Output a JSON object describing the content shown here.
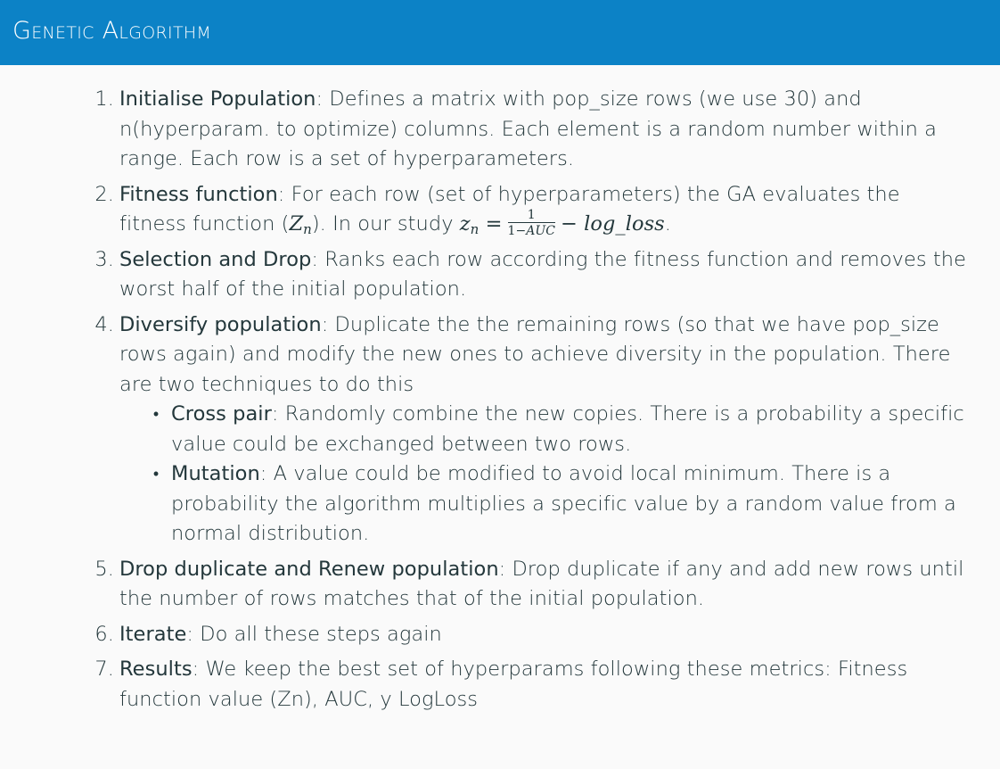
{
  "header": {
    "title": "Genetic Algorithm"
  },
  "steps": [
    {
      "number": "1.",
      "term": "Initialise Population",
      "text": ": Defines a matrix with pop_size rows (we use 30) and n(hyperparam. to optimize) columns. Each element is a random number within a range. Each row is a set of hyperparameters."
    },
    {
      "number": "2.",
      "term": "Fitness function",
      "text_before": ": For each row (set of hyperparameters) the GA evaluates the fitness function (",
      "math_z_var": "Z",
      "math_z_sub": "n",
      "text_mid": "). In our study ",
      "math_lhs_var": "z",
      "math_lhs_sub": "n",
      "math_equals": "=",
      "frac_num": "1",
      "frac_den_prefix": "1−",
      "frac_den_var": "AUC",
      "math_minus": "−",
      "math_rhs": "log_loss",
      "text_after": "."
    },
    {
      "number": "3.",
      "term": "Selection and Drop",
      "text": ": Ranks each row according the fitness function and removes the worst half of the initial population."
    },
    {
      "number": "4.",
      "term": "Diversify population",
      "text": ": Duplicate the the remaining rows (so that we have pop_size rows again) and modify the new ones to achieve diversity in the population. There are two techniques to do this",
      "subitems": [
        {
          "bullet": "•",
          "term": "Cross pair",
          "text": ": Randomly combine the new copies. There is a probability a specific value could be exchanged between two rows."
        },
        {
          "bullet": "•",
          "term": "Mutation",
          "text": ": A value could be modified to avoid local minimum. There is a probability the algorithm multiplies a specific value by a random value from a normal distribution."
        }
      ]
    },
    {
      "number": "5.",
      "term": "Drop duplicate and Renew population",
      "text": ": Drop duplicate if any and add new rows until the number of rows matches that of the initial population."
    },
    {
      "number": "6.",
      "term": "Iterate",
      "text": ": Do all these steps again"
    },
    {
      "number": "7.",
      "term": "Results",
      "text": ": We keep the best set of hyperparams following these metrics: Fitness function value (Zn), AUC, y LogLoss"
    }
  ]
}
